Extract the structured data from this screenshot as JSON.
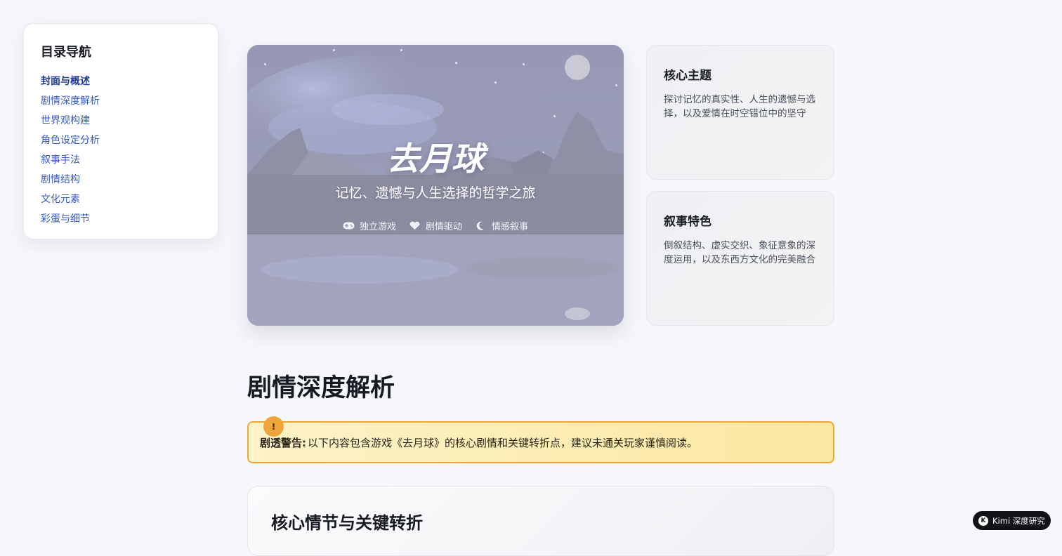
{
  "toc": {
    "title": "目录导航",
    "items": [
      {
        "label": "封面与概述",
        "active": true
      },
      {
        "label": "剧情深度解析"
      },
      {
        "label": "世界观构建"
      },
      {
        "label": "角色设定分析"
      },
      {
        "label": "叙事手法"
      },
      {
        "label": "剧情结构"
      },
      {
        "label": "文化元素"
      },
      {
        "label": "彩蛋与细节"
      }
    ]
  },
  "hero": {
    "title": "去月球",
    "subtitle": "记忆、遗憾与人生选择的哲学之旅",
    "tags": [
      {
        "icon": "gamepad-icon",
        "label": "独立游戏"
      },
      {
        "icon": "heart-icon",
        "label": "剧情驱动"
      },
      {
        "icon": "moon-icon",
        "label": "情感叙事"
      }
    ]
  },
  "cards": [
    {
      "title": "核心主题",
      "text": "探讨记忆的真实性、人生的遗憾与选择，以及爱情在时空错位中的坚守"
    },
    {
      "title": "叙事特色",
      "text": "倒叙结构、虚实交织、象征意象的深度运用，以及东西方文化的完美融合"
    }
  ],
  "section": {
    "title": "剧情深度解析"
  },
  "spoiler": {
    "badge": "!",
    "label": "剧透警告:",
    "text": "以下内容包含游戏《去月球》的核心剧情和关键转折点，建议未通关玩家谨慎阅读。"
  },
  "panel": {
    "title": "核心情节与关键转折"
  },
  "kimi": {
    "label": "Kimi 深度研究",
    "logo": "K"
  },
  "colors": {
    "accent": "#3458c8",
    "warning": "#f0a53a",
    "hero_bg": "#9a9cb8"
  }
}
